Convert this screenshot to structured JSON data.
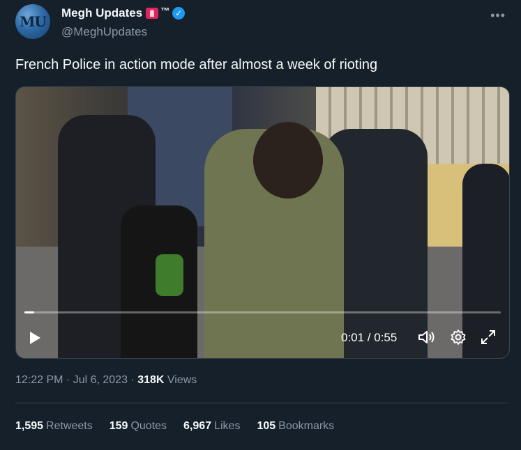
{
  "author": {
    "avatar_initials": "MU",
    "display_name": "Megh Updates",
    "tm": "™",
    "handle": "@MeghUpdates"
  },
  "tweet": {
    "text": "French Police in action mode after almost a week of rioting"
  },
  "video": {
    "time": "0:01 / 0:55",
    "progress_fraction": 0.02
  },
  "meta": {
    "time": "12:22 PM",
    "sep1": " · ",
    "date": "Jul 6, 2023",
    "sep2": " · ",
    "views_count": "318K",
    "views_label": "Views"
  },
  "stats": [
    {
      "count": "1,595",
      "label": "Retweets"
    },
    {
      "count": "159",
      "label": "Quotes"
    },
    {
      "count": "6,967",
      "label": "Likes"
    },
    {
      "count": "105",
      "label": "Bookmarks"
    }
  ],
  "colors": {
    "background": "#15202b",
    "verified": "#1d9bf0",
    "secondary_text": "#8b98a5"
  }
}
